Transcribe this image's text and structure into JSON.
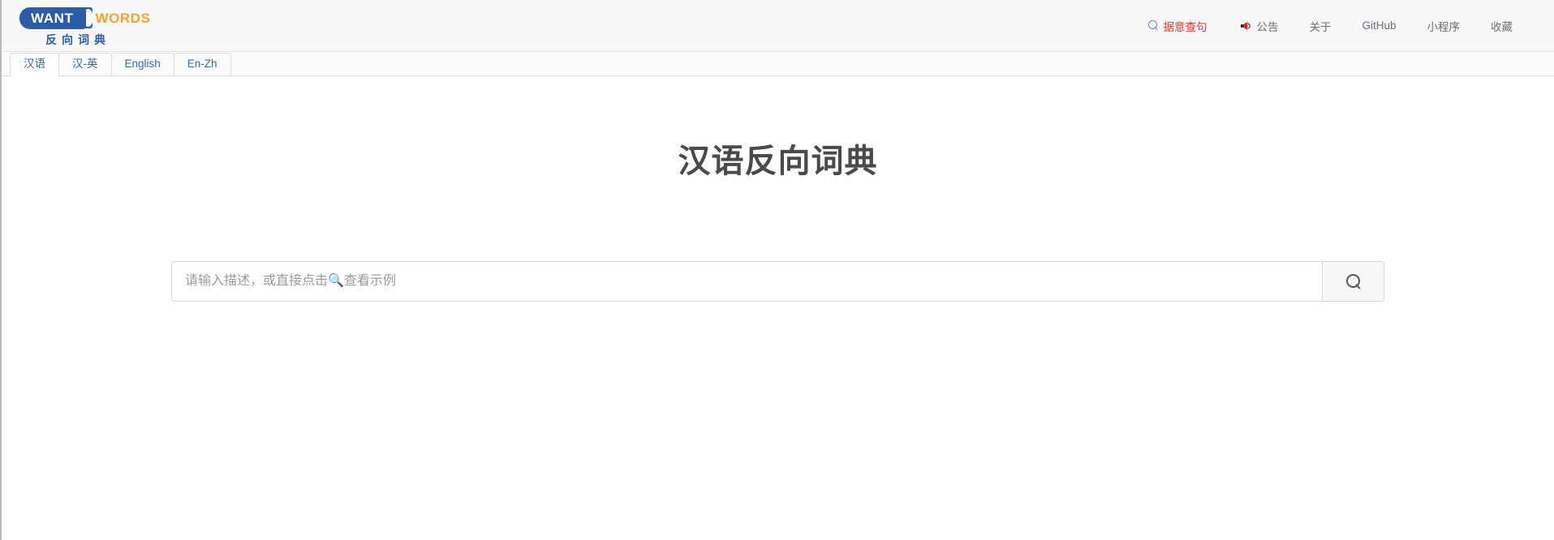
{
  "header": {
    "logo": {
      "want_text": "WANT",
      "words_text": "WORDS",
      "subtitle": "反向词典",
      "pill_color": "#2a5ca8",
      "words_color": "#f0a431"
    },
    "nav": [
      {
        "label": "据意查句",
        "icon": "search-icon",
        "color": "#e5362c"
      },
      {
        "label": "公告",
        "icon": "megaphone-icon",
        "color": "#6d6f73"
      },
      {
        "label": "关于",
        "icon": "",
        "color": "#6d6f73"
      },
      {
        "label": "GitHub",
        "icon": "",
        "color": "#6d6f73"
      },
      {
        "label": "小程序",
        "icon": "",
        "color": "#6d6f73"
      },
      {
        "label": "收藏",
        "icon": "",
        "color": "#6d6f73"
      }
    ]
  },
  "tabs": [
    {
      "label": "汉语",
      "active": true
    },
    {
      "label": "汉-英",
      "active": false
    },
    {
      "label": "English",
      "active": false
    },
    {
      "label": "En-Zh",
      "active": false
    }
  ],
  "main": {
    "title": "汉语反向词典",
    "search": {
      "value": "",
      "placeholder": "请输入描述，或直接点击🔍查看示例",
      "button_icon": "search-icon"
    }
  }
}
